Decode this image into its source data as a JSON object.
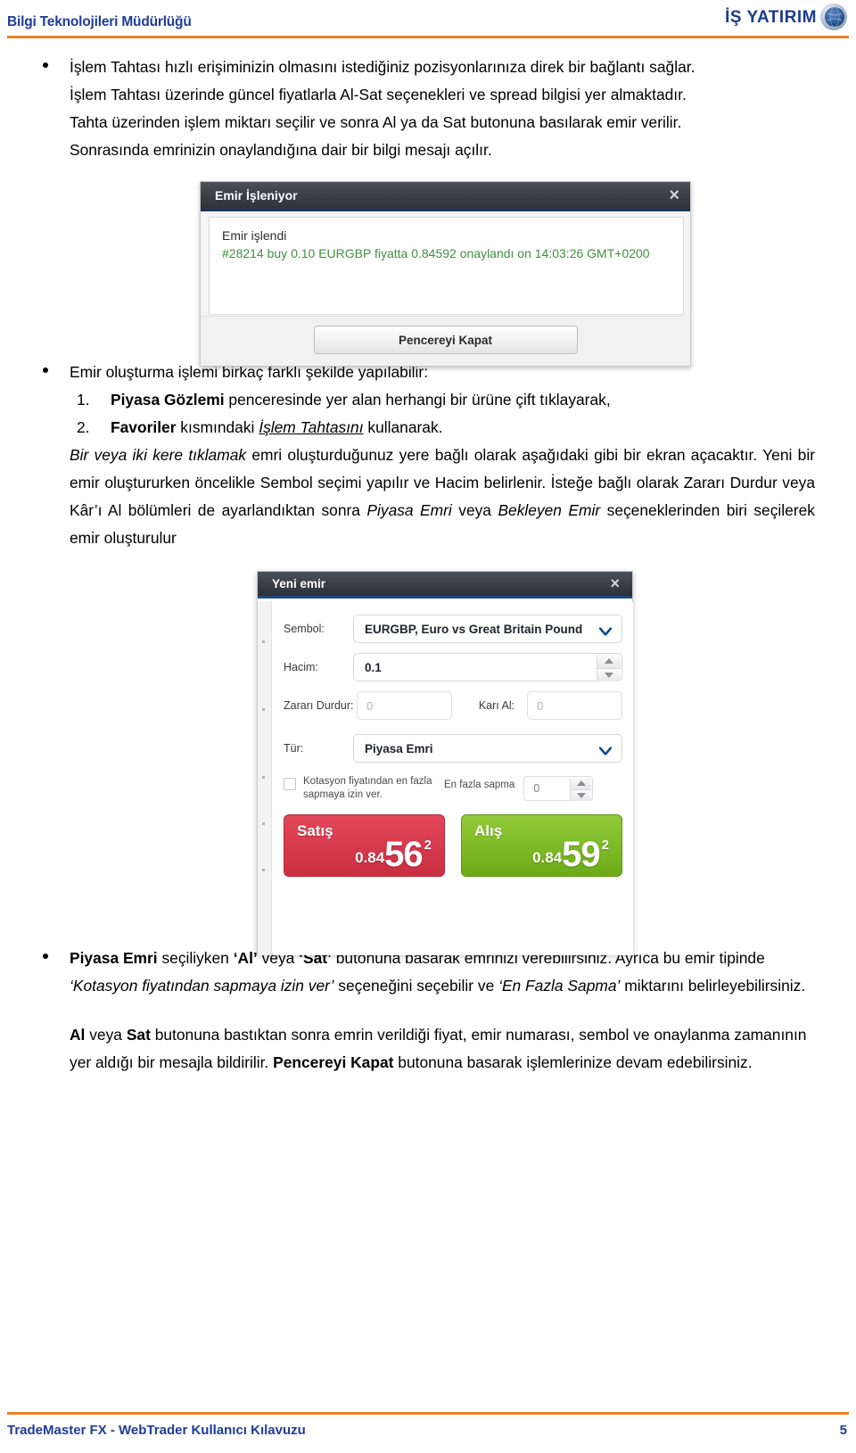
{
  "header": {
    "title": "Bilgi Teknolojileri Müdürlüğü",
    "logo_text": "İŞ YATIRIM",
    "accent_color": "#ef8022",
    "brand_color": "#1f3b99"
  },
  "content": {
    "bullet1_line1": "İşlem Tahtası hızlı erişiminizin olmasını istediğiniz pozisyonlarınıza direk bir bağlantı sağlar.",
    "bullet1_line2": "İşlem Tahtası üzerinde güncel fiyatlarla Al-Sat seçenekleri ve spread bilgisi yer almaktadır.",
    "bullet1_line3": "Tahta üzerinden işlem miktarı seçilir ve sonra Al ya da Sat butonuna basılarak emir verilir.",
    "bullet1_line4": "Sonrasında emrinizin onaylandığına dair bir  bilgi mesajı açılır.",
    "bullet2_intro": "Emir oluşturma işlemi birkaç farklı şekilde yapılabilir:",
    "list": [
      {
        "num": "1.",
        "bold": "Piyasa Gözlemi",
        "rest": " penceresinde yer alan herhangi bir ürüne çift tıklayarak,"
      },
      {
        "num": "2.",
        "bold": "Favoriler",
        "rest_pre": " kısmındaki ",
        "italic_underline": "İşlem Tahtasını",
        "rest_post": " kullanarak."
      }
    ],
    "para_after_list": {
      "i1": "Bir veya iki kere tıklamak",
      "t1": " emri oluşturduğunuz yere bağlı olarak aşağıdaki gibi bir ekran açacaktır. Yeni bir emir oluştururken öncelikle Sembol seçimi yapılır ve Hacim belirlenir. İsteğe bağlı olarak Zararı Durdur veya Kâr’ı Al bölümleri de ayarlandıktan sonra ",
      "i2": "Piyasa Emri",
      "t2": " veya ",
      "i3": "Bekleyen Emir",
      "t3": " seçeneklerinden biri seçilerek emir oluşturulur"
    },
    "bullet3": {
      "b1": "Piyasa Emri",
      "t1": " seçiliyken ",
      "b2": "‘Al’",
      "t2": " veya ",
      "b3": "‘Sat’",
      "t3": " butonuna basarak emrinizi verebilirsiniz. Ayrıca bu emir tipinde ",
      "i1": "‘Kotasyon fiyatından sapmaya izin ver’",
      "t4": " seçeneğini seçebilir ve ",
      "i2": "‘En Fazla Sapma’",
      "t5": " miktarını belirleyebilirsiniz."
    },
    "para_final": {
      "b1": "Al",
      "t1": " veya ",
      "b2": "Sat",
      "t2": " butonuna bastıktan sonra emrin verildiği fiyat, emir numarası, sembol ve onaylanma zamanının yer aldığı bir mesajla bildirilir. ",
      "b3": "Pencereyi Kapat",
      "t3": " butonuna basarak işlemlerinize devam edebilirsiniz."
    }
  },
  "dialog_order_processing": {
    "title": "Emir İşleniyor",
    "close_icon": "×",
    "message_line1": "Emir işlendi",
    "message_line2": "#28214 buy 0.10 EURGBP fiyatta 0.84592 onaylandı on 14:03:26 GMT+0200",
    "message_color": "#3f8f3f",
    "close_button": "Pencereyi Kapat"
  },
  "dialog_new_order": {
    "title": "Yeni emir",
    "close_icon": "×",
    "symbol_label": "Sembol:",
    "symbol_value": "EURGBP, Euro vs Great Britain Pound",
    "volume_label": "Hacim:",
    "volume_value": "0.1",
    "stoploss_label": "Zararı Durdur:",
    "stoploss_value": "0",
    "takeprofit_label": "Karı Al:",
    "takeprofit_value": "0",
    "type_label": "Tür:",
    "type_value": "Piyasa Emri",
    "deviation_checkbox_label": "Kotasyon fiyatından en fazla sapmaya izin ver.",
    "deviation_checked": false,
    "deviation_label": "En fazla sapma",
    "deviation_value": "0",
    "sell_button": {
      "label": "Satış",
      "price_small": "0.84",
      "price_big": "56",
      "price_sup": "2",
      "color": "#d83a4d"
    },
    "buy_button": {
      "label": "Alış",
      "price_small": "0.84",
      "price_big": "59",
      "price_sup": "2",
      "color": "#7fbb28"
    }
  },
  "footer": {
    "text": "TradeMaster FX - WebTrader Kullanıcı Kılavuzu",
    "page_number": "5"
  }
}
